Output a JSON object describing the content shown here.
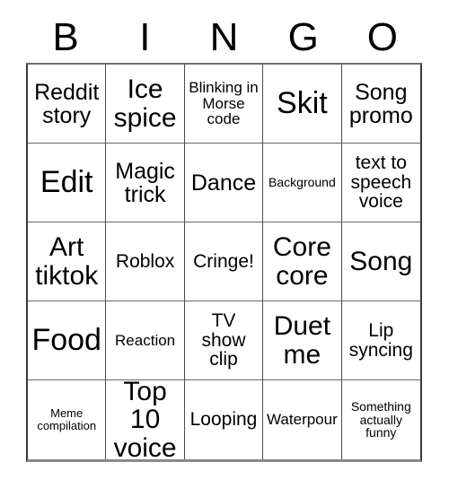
{
  "card": {
    "header_letters": [
      "B",
      "I",
      "N",
      "G",
      "O"
    ],
    "grid_size": 5,
    "colors": {
      "text": "#000000",
      "grid_line": "#4a4a4a",
      "background": "#ffffff"
    },
    "cells": [
      {
        "text": "Reddit story",
        "size": "lg"
      },
      {
        "text": "Ice spice",
        "size": "xl"
      },
      {
        "text": "Blinking in Morse code",
        "size": "sm"
      },
      {
        "text": "Skit",
        "size": "xxl"
      },
      {
        "text": "Song promo",
        "size": "lg"
      },
      {
        "text": "Edit",
        "size": "xxl"
      },
      {
        "text": "Magic trick",
        "size": "lg"
      },
      {
        "text": "Dance",
        "size": "lg"
      },
      {
        "text": "Background",
        "size": "xs"
      },
      {
        "text": "text to speech voice",
        "size": "md"
      },
      {
        "text": "Art tiktok",
        "size": "xl"
      },
      {
        "text": "Roblox",
        "size": "md"
      },
      {
        "text": "Cringe!",
        "size": "md"
      },
      {
        "text": "Core core",
        "size": "xl"
      },
      {
        "text": "Song",
        "size": "xl"
      },
      {
        "text": "Food",
        "size": "xxl"
      },
      {
        "text": "Reaction",
        "size": "sm"
      },
      {
        "text": "TV show clip",
        "size": "md"
      },
      {
        "text": "Duet me",
        "size": "xl"
      },
      {
        "text": "Lip syncing",
        "size": "md"
      },
      {
        "text": "Meme compilation",
        "size": "xxs"
      },
      {
        "text": "Top 10 voice",
        "size": "xl"
      },
      {
        "text": "Looping",
        "size": "md"
      },
      {
        "text": "Waterpour",
        "size": "sm"
      },
      {
        "text": "Something actually funny",
        "size": "xs"
      }
    ]
  }
}
